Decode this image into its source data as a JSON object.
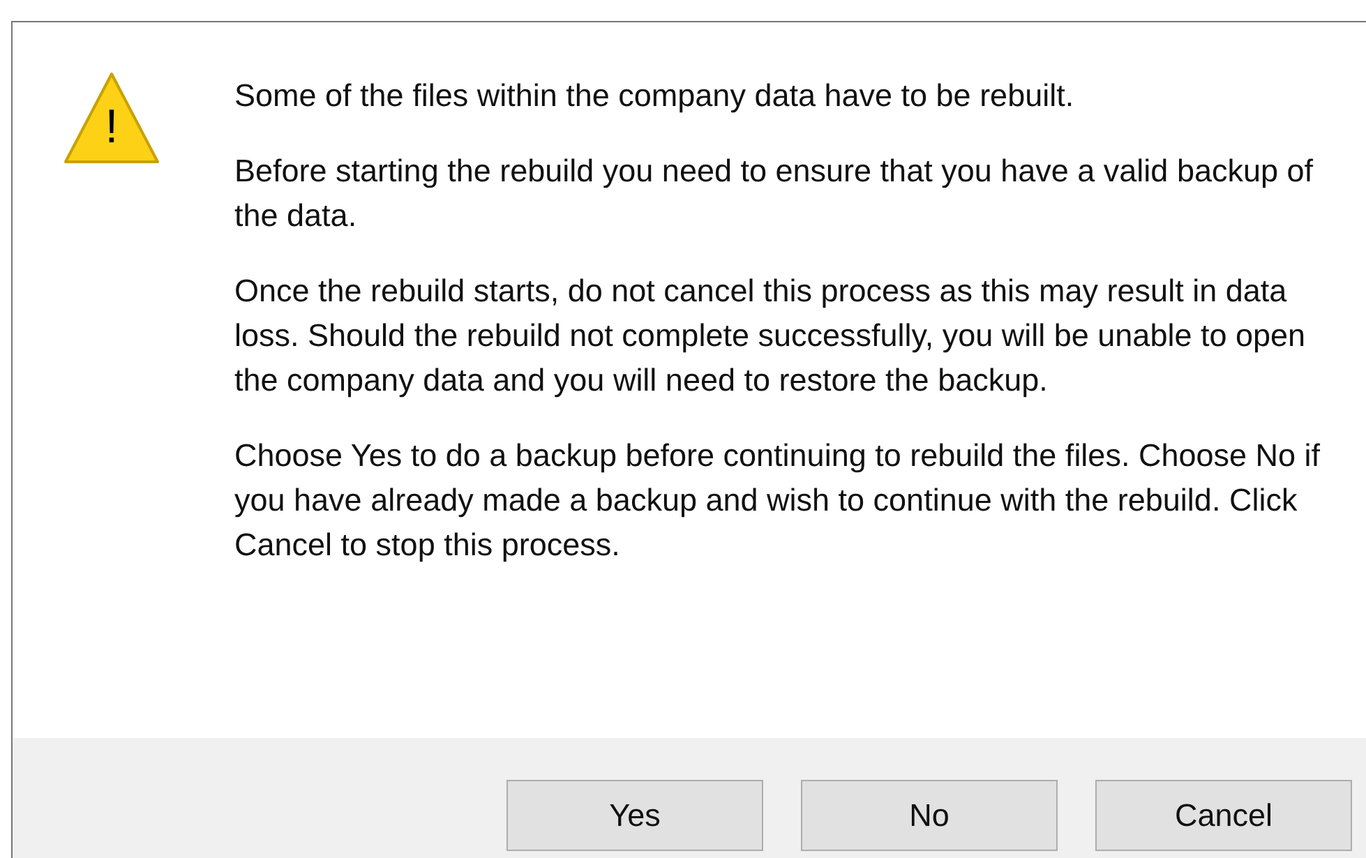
{
  "dialog": {
    "icon": "!",
    "paragraphs": [
      "Some of the files within the company data have to be rebuilt.",
      "Before starting the rebuild you need to ensure that you have a valid backup of the data.",
      "Once the rebuild starts, do not cancel this process as this may result in data loss.  Should the rebuild not complete successfully, you will be unable to open the company data and you will need to restore the backup.",
      "Choose Yes to do a backup before continuing to rebuild the files. Choose No if you have already made a backup and wish to continue with the rebuild.  Click Cancel to stop this process."
    ],
    "buttons": [
      "Yes",
      "No",
      "Cancel"
    ]
  }
}
